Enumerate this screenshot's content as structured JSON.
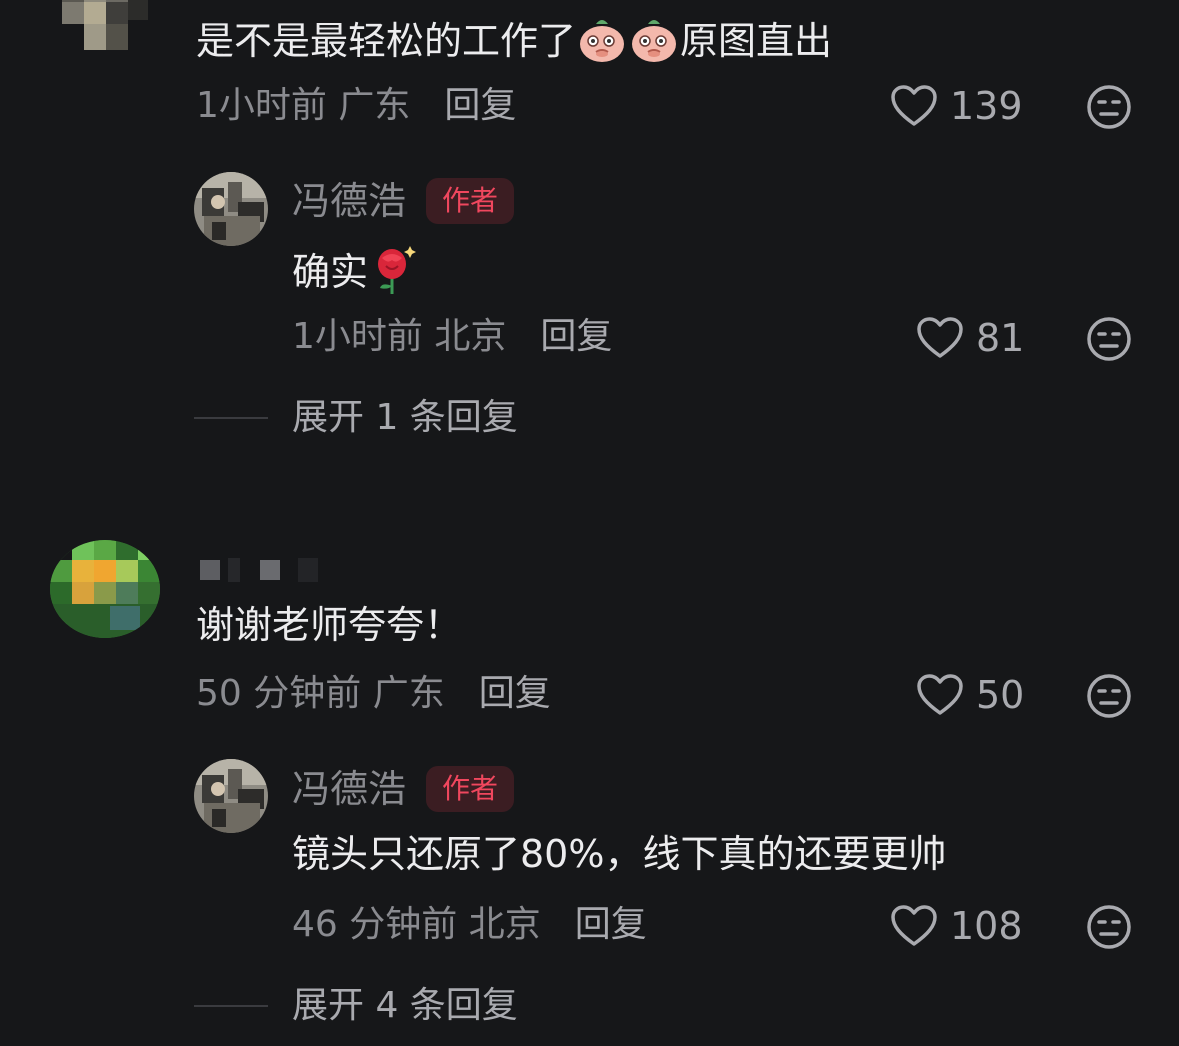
{
  "comment1": {
    "text_before": "是不是最轻松的工作了",
    "text_after": "原图直出",
    "emoji": "peach-face-emoji",
    "time_location": "1小时前 广东",
    "reply_label": "回复",
    "likes": "139"
  },
  "reply1": {
    "author": "冯德浩",
    "badge": "作者",
    "text": "确实",
    "emoji": "rose-emoji",
    "time_location": "1小时前 北京",
    "reply_label": "回复",
    "likes": "81",
    "expand": "展开 1 条回复"
  },
  "comment2": {
    "text": "谢谢老师夸夸！",
    "time_location": "50 分钟前 广东",
    "reply_label": "回复",
    "likes": "50"
  },
  "reply2": {
    "author": "冯德浩",
    "badge": "作者",
    "text": "镜头只还原了80%，线下真的还要更帅",
    "time_location": "46 分钟前 北京",
    "reply_label": "回复",
    "likes": "108",
    "expand": "展开 4 条回复"
  },
  "colors": {
    "background": "#161719",
    "badge_text": "#f0475e",
    "badge_bg": "#3b1d22",
    "meta": "#8a8b90"
  },
  "icons": [
    "heart-outline-icon",
    "unamused-face-icon"
  ]
}
